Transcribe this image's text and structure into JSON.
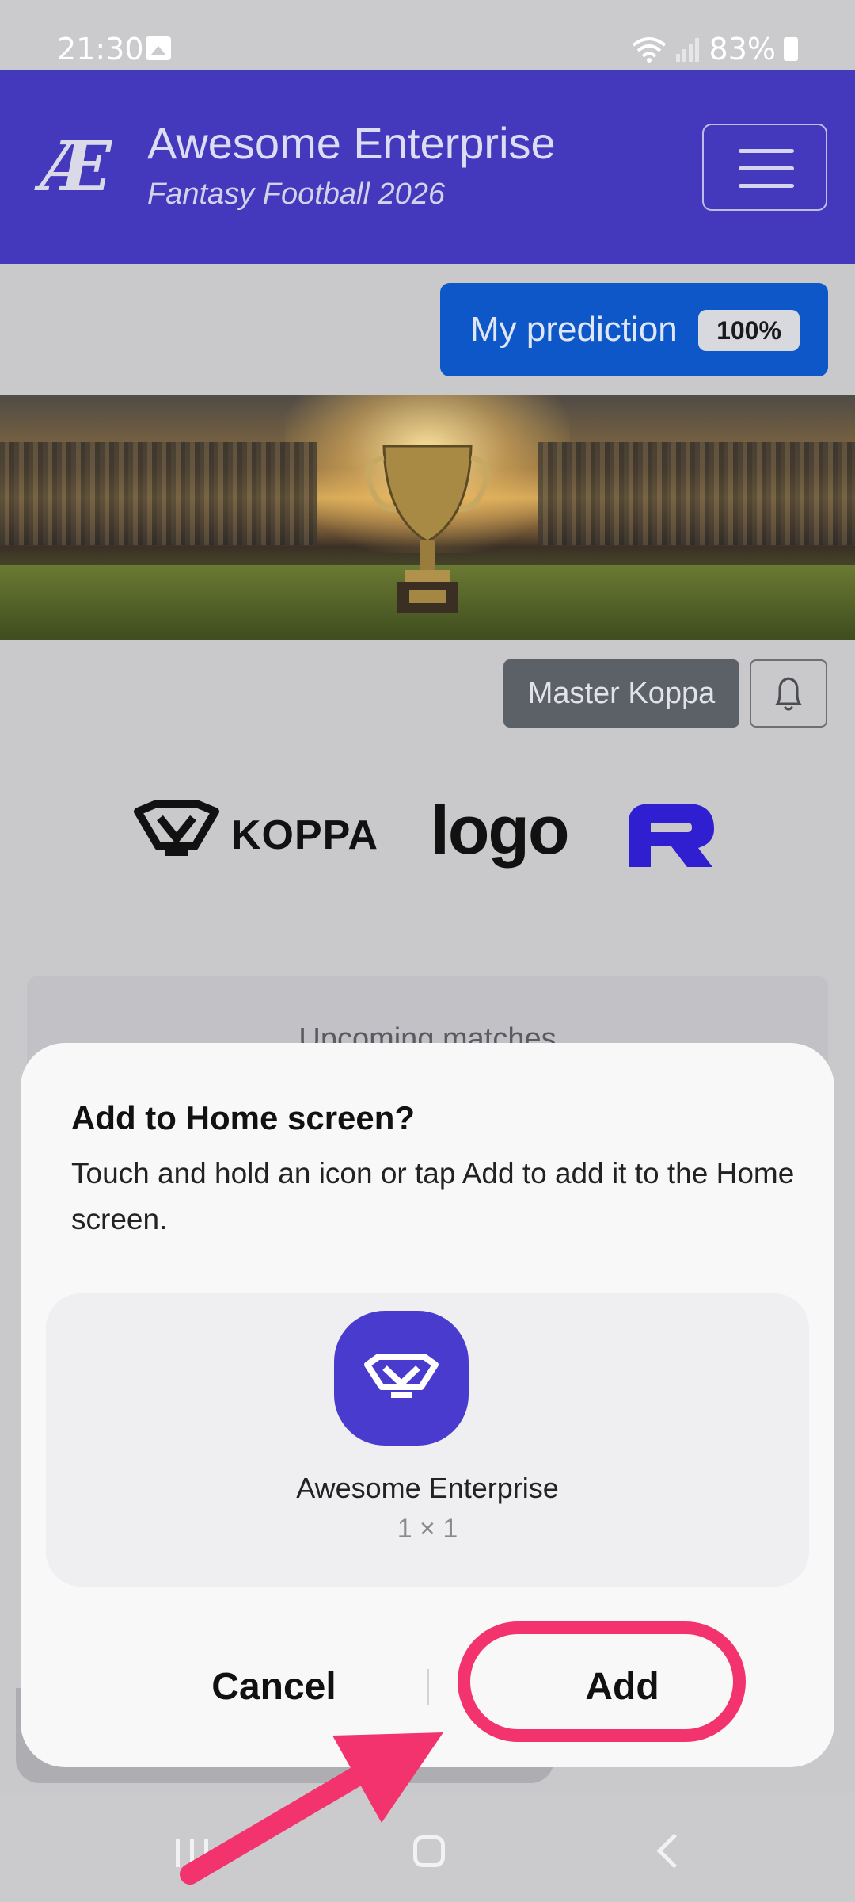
{
  "status_bar": {
    "time": "21:30",
    "battery": "83%",
    "icons": [
      "gallery-icon",
      "wifi-icon",
      "signal-icon",
      "battery-icon"
    ]
  },
  "header": {
    "logo_text": "Æ",
    "title": "Awesome Enterprise",
    "subtitle": "Fantasy Football 2026",
    "menu_icon": "hamburger-menu-icon",
    "color": "#4438bd"
  },
  "prediction": {
    "label": "My prediction",
    "badge": "100%",
    "color": "#0d57c9"
  },
  "hero": {
    "image": "trophy-stadium-banner"
  },
  "user": {
    "name": "Master Koppa",
    "bell_icon": "bell-icon"
  },
  "sponsors": {
    "koppa": "KOPPA",
    "logo": "logo",
    "third": "r-logo"
  },
  "upcoming": {
    "title": "Upcoming matches"
  },
  "dialog": {
    "title": "Add to Home screen?",
    "description": "Touch and hold an icon or tap Add to add it to the Home screen.",
    "app_name": "Awesome Enterprise",
    "app_size": "1 × 1",
    "cancel_label": "Cancel",
    "add_label": "Add",
    "highlight_color": "#f2336e"
  },
  "nav_bar": {
    "icons": [
      "recent-apps-icon",
      "home-icon",
      "back-icon"
    ]
  }
}
